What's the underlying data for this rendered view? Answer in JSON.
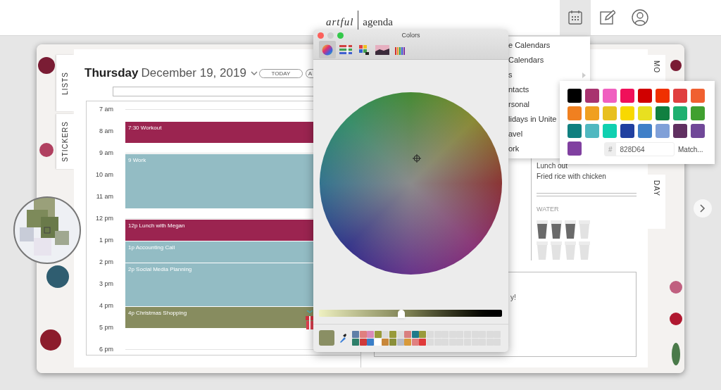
{
  "header": {
    "logo_first": "artful",
    "logo_second": "agenda",
    "icons": [
      {
        "kind": "calendar",
        "selected": true
      },
      {
        "kind": "edit",
        "selected": false
      },
      {
        "kind": "profile",
        "selected": false
      }
    ]
  },
  "left_tabs": [
    {
      "label": "LISTS"
    },
    {
      "label": "STICKERS"
    }
  ],
  "right_tabs": [
    {
      "label": "MO"
    },
    {
      "label": "DAY"
    }
  ],
  "day_view": {
    "weekday": "Thursday",
    "date": "December 19, 2019",
    "buttons": [
      "TODAY",
      "A"
    ],
    "hours": [
      "7 am",
      "8 am",
      "9 am",
      "10 am",
      "11 am",
      "12 pm",
      "1 pm",
      "2 pm",
      "3 pm",
      "4 pm",
      "5 pm",
      "6 pm"
    ],
    "events": [
      {
        "title": "7:30 Workout",
        "color": "#9b2450"
      },
      {
        "title": "9 Work",
        "color": "#93bcc4"
      },
      {
        "title": "12p Lunch with Megan",
        "color": "#9b2450"
      },
      {
        "title": "1p Accounting Call",
        "color": "#93bcc4"
      },
      {
        "title": "2p Social Media Planning",
        "color": "#93bcc4"
      },
      {
        "title": "4p Christmas Shopping",
        "color": "#878c5f"
      }
    ]
  },
  "right_page": {
    "notes": [
      "Lunch out",
      "Fried rice with chicken"
    ],
    "water": {
      "label": "WATER",
      "glasses": [
        {
          "filled": true
        },
        {
          "filled": true
        },
        {
          "filled": true
        },
        {
          "filled": false
        },
        {
          "filled": false
        },
        {
          "filled": false
        },
        {
          "filled": false
        },
        {
          "filled": false
        }
      ]
    },
    "box_text": "y!"
  },
  "calendar_menu": {
    "items": [
      {
        "label": "e Calendars",
        "submenu": false
      },
      {
        "label": "Calendars",
        "submenu": false
      },
      {
        "label": "s",
        "submenu": true
      },
      {
        "label": "ntacts",
        "submenu": false
      },
      {
        "label": "rsonal",
        "submenu": false
      },
      {
        "label": "lidays in Unite",
        "submenu": false
      },
      {
        "label": "avel",
        "submenu": false
      },
      {
        "label": "ork",
        "submenu": false
      }
    ]
  },
  "color_palette": {
    "swatches": [
      {
        "color": "#000000"
      },
      {
        "color": "#a8336f"
      },
      {
        "color": "#f060c0"
      },
      {
        "color": "#f0105a"
      },
      {
        "color": "#d00000"
      },
      {
        "color": "#f03000"
      },
      {
        "color": "#e04040"
      },
      {
        "color": "#f06030"
      },
      {
        "color": "#f08020"
      },
      {
        "color": "#f0a020"
      },
      {
        "color": "#e8c020"
      },
      {
        "color": "#f8d800"
      },
      {
        "color": "#e8e020"
      },
      {
        "color": "#108040"
      },
      {
        "color": "#20b070"
      },
      {
        "color": "#40a030"
      },
      {
        "color": "#108080"
      },
      {
        "color": "#50b8c0"
      },
      {
        "color": "#10d0b0"
      },
      {
        "color": "#2040a0"
      },
      {
        "color": "#4080c8"
      },
      {
        "color": "#80a0d8"
      },
      {
        "color": "#603060"
      },
      {
        "color": "#704898"
      },
      {
        "color": "#8040a0"
      }
    ],
    "hash": "#",
    "hex": "828D64",
    "match": "Match..."
  },
  "colors_window": {
    "title": "Colors",
    "modes": [
      {
        "kind": "wheel",
        "selected": true
      },
      {
        "kind": "sliders",
        "selected": false
      },
      {
        "kind": "palettes",
        "selected": false
      },
      {
        "kind": "image",
        "selected": false
      },
      {
        "kind": "pencils",
        "selected": false
      }
    ],
    "brightness": {
      "level": 0.45
    },
    "current": [
      {
        "color": "#8a8f64"
      }
    ],
    "swatches": [
      {
        "color": "#5f7fa8"
      },
      {
        "color": "#e07f7f"
      },
      {
        "color": "#d98bb8"
      },
      {
        "color": "#999a3a"
      },
      {
        "color": "#dcdcdc"
      },
      {
        "color": "#989a3a"
      },
      {
        "color": "#dcdcdc"
      },
      {
        "color": "#d97f7f"
      },
      {
        "color": "#1f7a8a"
      },
      {
        "color": "#9a9a3a"
      },
      {
        "color": "#2e7f6a"
      },
      {
        "color": "#d03a3a"
      },
      {
        "color": "#3a7fc8"
      },
      {
        "color": "#ffffff"
      },
      {
        "color": "#c8873a"
      },
      {
        "color": "#8a8f3a"
      },
      {
        "color": "#b8bcc8"
      },
      {
        "color": "#d89a3a"
      },
      {
        "color": "#e08080"
      },
      {
        "color": "#e03a3a"
      }
    ]
  }
}
